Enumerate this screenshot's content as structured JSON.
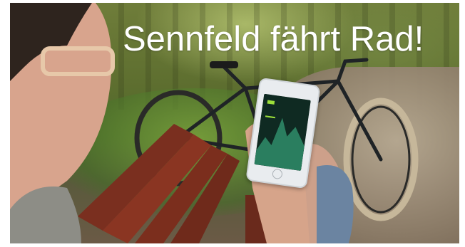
{
  "headline": {
    "text": "Sennfeld fährt Rad!",
    "color": "#ffffff"
  },
  "photo": {
    "subject": "person on park bench holding smartphone, bicycle leaning nearby"
  }
}
